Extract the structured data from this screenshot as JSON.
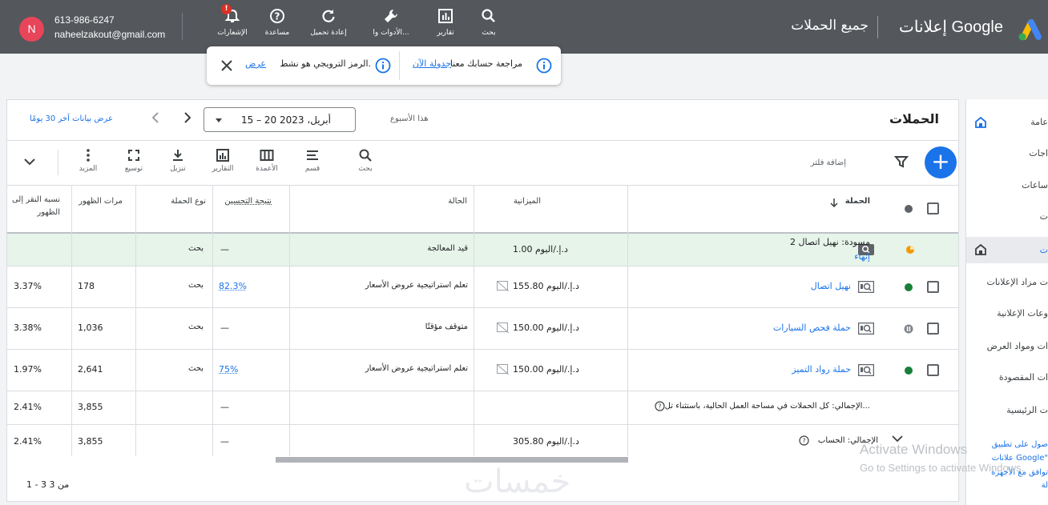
{
  "topbar": {
    "brand": "إعلانات Google",
    "page_title": "جميع الحملات",
    "tools": [
      {
        "label": "بحث",
        "icon": "search-icon"
      },
      {
        "label": "تقارير",
        "icon": "reports-icon"
      },
      {
        "label": "الأدوات وا...",
        "icon": "wrench-icon"
      },
      {
        "label": "إعادة تحميل",
        "icon": "refresh-icon"
      },
      {
        "label": "مساعدة",
        "icon": "help-icon"
      },
      {
        "label": "الإشعارات",
        "icon": "bell-icon"
      }
    ],
    "notif_badge": "!",
    "phone": "613-986-6247",
    "email": "naheelzakout@gmail.com",
    "avatar_letter": "N"
  },
  "notification": {
    "review_text": "مراجعة حسابك معنا",
    "review_link": "جدولة الآن",
    "promo_text": "الرمز الترويجي هو نشط.",
    "promo_link": "عرض"
  },
  "sidebar": {
    "items": [
      "عامة",
      "اجات",
      "ساعات",
      "ت",
      "ت",
      "ت مزاد الإعلانات",
      "وعات الإعلانية",
      "ات ومواد العرض",
      "ات المقصودة",
      "ت الرئيسية"
    ],
    "bottom": [
      "صول على تطبيق",
      "علانات Google\"",
      "توافق مع الأجهزة",
      "لة"
    ]
  },
  "main": {
    "title": "الحملات",
    "week_label": "هذا الأسبوع",
    "date_range": "15 – 20 أبريل، 2023",
    "last30": "عرض بيانات آخر 30 يومًا",
    "filter_label": "إضافة فلتر",
    "toolbar": [
      {
        "label": "بحث",
        "icon": "search-icon"
      },
      {
        "label": "قسم",
        "icon": "segment-icon"
      },
      {
        "label": "الأعمدة",
        "icon": "columns-icon"
      },
      {
        "label": "التقارير",
        "icon": "chart-icon"
      },
      {
        "label": "تنزيل",
        "icon": "download-icon"
      },
      {
        "label": "توسيع",
        "icon": "expand-icon"
      },
      {
        "label": "المزيد",
        "icon": "more-icon"
      }
    ],
    "columns": {
      "campaign": "الحملة",
      "budget": "الميزانية",
      "status": "الحالة",
      "opt_score": "نتيجة التحسين",
      "type": "نوع الحملة",
      "impressions": "مرات الظهور",
      "ctr_line1": "نسبة النقر إلى",
      "ctr_line2": "الظهور"
    },
    "draft_row": {
      "name": "مسودة: نهيل اتصال 2",
      "action": "إنهاء",
      "budget": "1.00 د.إ./اليوم",
      "status": "قيد المعالجة",
      "opt": "—",
      "type": "بحث",
      "status_color": "#f29900"
    },
    "rows": [
      {
        "name": "نهيل اتصال",
        "budget": "155.80 د.إ./اليوم",
        "status": "تعلم استراتيجية عروض الأسعار",
        "opt": "82.3%",
        "type": "بحث",
        "impr": "178",
        "ctr": "3.37%",
        "status_color": "#188038",
        "state": "enabled"
      },
      {
        "name": "حملة فحص السيارات",
        "budget": "150.00 د.إ./اليوم",
        "status": "متوقف مؤقتًا",
        "opt": "—",
        "type": "بحث",
        "impr": "1,036",
        "ctr": "3.38%",
        "status_color": "#80868b",
        "state": "paused"
      },
      {
        "name": "حملة رواد التميز",
        "budget": "150.00 د.إ./اليوم",
        "status": "تعلم استراتيجية عروض الأسعار",
        "opt": "75%",
        "type": "بحث",
        "impr": "2,641",
        "ctr": "1.97%",
        "status_color": "#188038",
        "state": "enabled"
      }
    ],
    "total_workspace": {
      "label": "الإجمالي: كل الحملات في مساحة العمل الحالية، باستثناء تل...",
      "opt": "—",
      "impr": "3,855",
      "ctr": "2.41%"
    },
    "total_account": {
      "label": "الإجمالي: الحساب",
      "budget": "305.80 د.إ./اليوم",
      "opt": "—",
      "impr": "3,855",
      "ctr": "2.41%"
    },
    "pager": "1 - 3 من 3"
  },
  "overlay": {
    "watermark": "خمسات",
    "activate_title": "Activate Windows",
    "activate_sub": "Go to Settings to activate Windows."
  },
  "colors": {
    "topbar": "#54575c",
    "accent": "#1a73e8",
    "draft_bg": "#e6f4ea"
  }
}
